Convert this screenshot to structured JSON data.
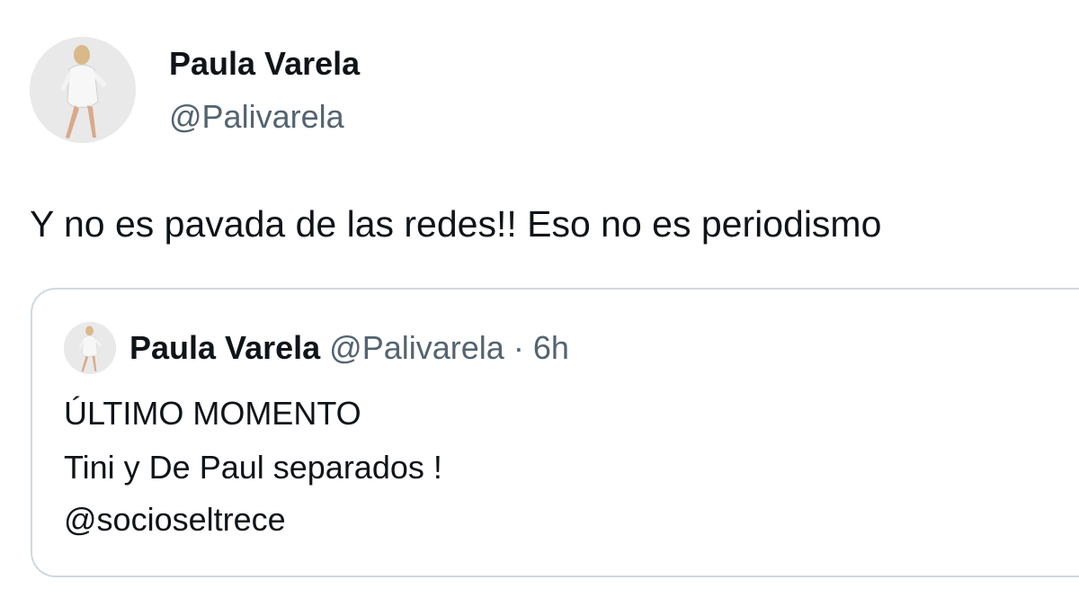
{
  "tweet": {
    "author_name": "Paula Varela",
    "author_handle": "@Palivarela",
    "text": "Y no es pavada de las redes!! Eso no es periodismo"
  },
  "quoted_tweet": {
    "author_name": "Paula Varela",
    "author_handle": "@Palivarela",
    "separator": "·",
    "time": "6h",
    "lines": [
      "ÚLTIMO MOMENTO",
      "Tini y De Paul separados !",
      "@socioseltrece"
    ]
  },
  "colors": {
    "text": "#0f1419",
    "secondary": "#536471",
    "border": "#cfd9de"
  },
  "icons": {
    "avatar": "profile-photo"
  }
}
